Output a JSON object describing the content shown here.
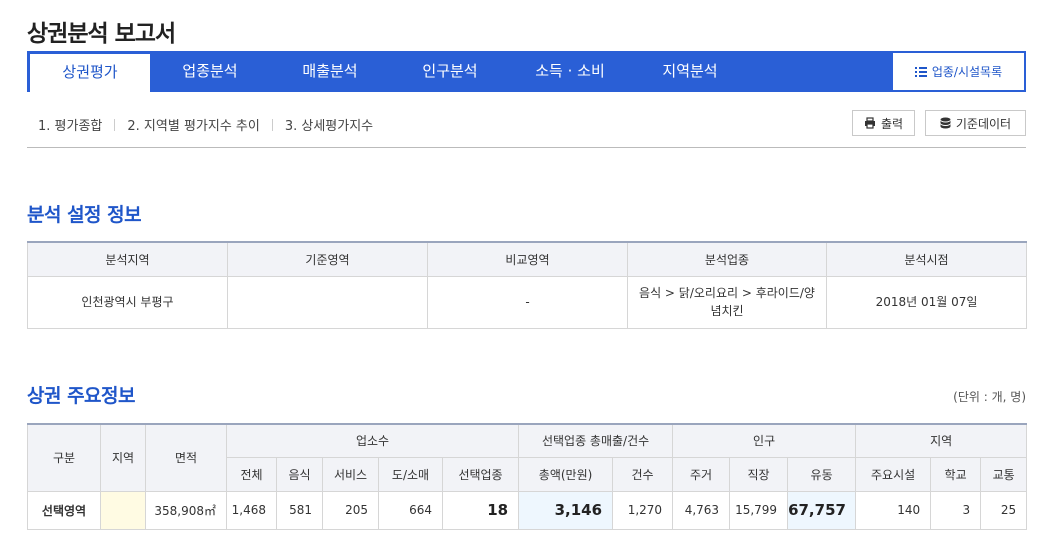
{
  "page_title": "상권분석 보고서",
  "tabs": [
    {
      "label": "상권평가",
      "active": true
    },
    {
      "label": "업종분석"
    },
    {
      "label": "매출분석"
    },
    {
      "label": "인구분석"
    },
    {
      "label": "소득 · 소비"
    },
    {
      "label": "지역분석"
    }
  ],
  "facility_button": {
    "label": "업종/시설목록",
    "icon": "list-icon"
  },
  "subnav": [
    "1. 평가종합",
    "2. 지역별 평가지수 추이",
    "3. 상세평가지수"
  ],
  "utility": {
    "print_label": "출력",
    "print_icon": "printer-icon",
    "data_label": "기준데이터",
    "data_icon": "database-icon"
  },
  "settings": {
    "title": "분석 설정 정보",
    "headers": [
      "분석지역",
      "기준영역",
      "비교영역",
      "분석업종",
      "분석시점"
    ],
    "values": [
      "인천광역시 부평구",
      "",
      "-",
      "음식 > 닭/오리요리 > 후라이드/양념치킨",
      "2018년 01월 07일"
    ]
  },
  "major": {
    "title": "상권 주요정보",
    "unit": "(단위 : 개, 명)",
    "head": {
      "category": "구분",
      "region": "지역",
      "area": "면적",
      "businesses": "업소수",
      "sales": "선택업종 총매출/건수",
      "population": "인구",
      "district": "지역"
    },
    "subhead": [
      "전체",
      "음식",
      "서비스",
      "도/소매",
      "선택업종",
      "총액(만원)",
      "건수",
      "주거",
      "직장",
      "유동",
      "주요시설",
      "학교",
      "교통"
    ],
    "row": {
      "label": "선택영역",
      "region": "",
      "area": "358,908㎡",
      "values": [
        "1,468",
        "581",
        "205",
        "664",
        "18",
        "3,146",
        "1,270",
        "4,763",
        "15,799",
        "67,757",
        "140",
        "3",
        "25"
      ]
    }
  },
  "colors": {
    "primary": "#2a5fd6",
    "accent_text": "#1f56c9",
    "header_bg": "#f2f3f7",
    "highlight_yellow": "#fffbe3",
    "highlight_blue": "#eef7fe"
  }
}
